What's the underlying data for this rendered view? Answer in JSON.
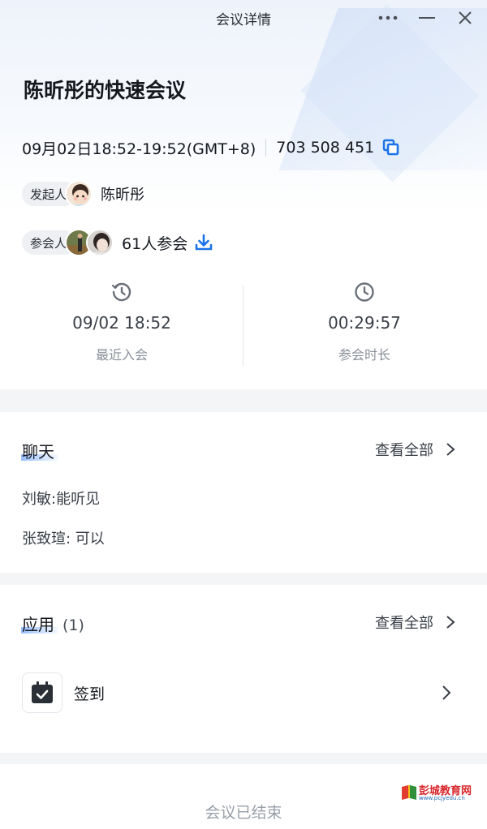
{
  "window": {
    "title": "会议详情",
    "controls": {
      "more": "more-icon",
      "minimize": "minimize-icon",
      "close": "close-icon"
    }
  },
  "meeting": {
    "title": "陈昕彤的快速会议",
    "time": "09月02日18:52-19:52(GMT+8)",
    "meeting_id": "703 508 451",
    "host_tag": "发起人",
    "host_name": "陈昕彤",
    "participants_tag": "参会人",
    "participants_count": "61人参会"
  },
  "stats": {
    "last_join_value": "09/02 18:52",
    "last_join_label": "最近入会",
    "duration_value": "00:29:57",
    "duration_label": "参会时长"
  },
  "chat": {
    "title": "聊天",
    "view_all": "查看全部",
    "messages": [
      {
        "text": "刘敏:能听见"
      },
      {
        "text": "张致瑄: 可以"
      }
    ]
  },
  "apps": {
    "title": "应用",
    "count": "(1)",
    "view_all": "查看全部",
    "items": [
      {
        "label": "签到",
        "icon": "checkin-calendar-icon"
      }
    ]
  },
  "footer": {
    "status": "会议已结束"
  },
  "watermark": {
    "text": "彭城教育网",
    "sub": "www.pcjyedu.cn"
  },
  "colors": {
    "accent": "#1a73e8",
    "highlight": "#609cff",
    "muted": "#8a9099"
  }
}
